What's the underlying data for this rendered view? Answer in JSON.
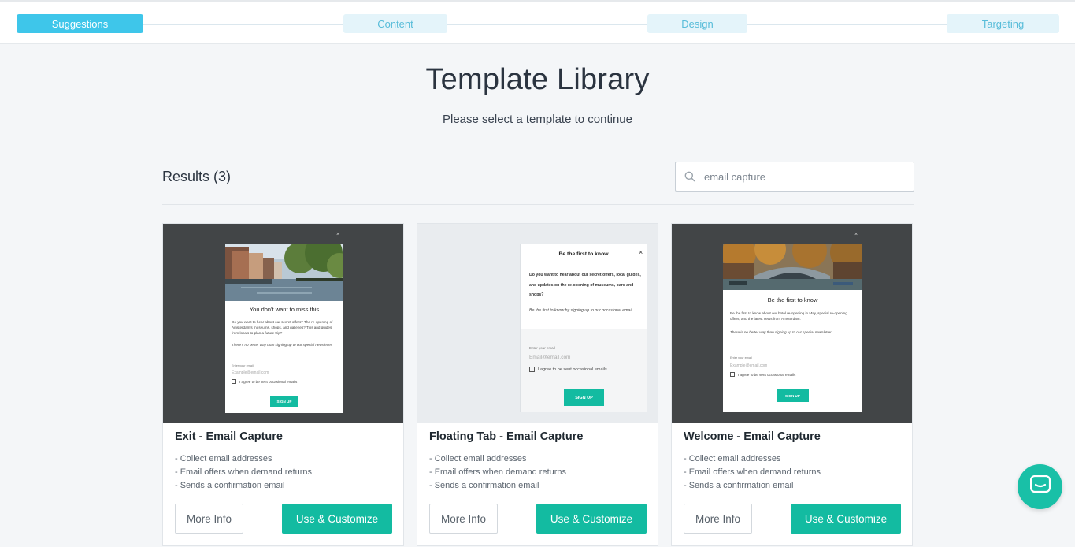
{
  "stepper": {
    "steps": [
      {
        "label": "Suggestions",
        "active": true
      },
      {
        "label": "Content",
        "active": false
      },
      {
        "label": "Design",
        "active": false
      },
      {
        "label": "Targeting",
        "active": false
      }
    ]
  },
  "header": {
    "title": "Template Library",
    "subtitle": "Please select a template to continue"
  },
  "results": {
    "label": "Results (3)"
  },
  "search": {
    "value": "email capture",
    "icon": "search-icon"
  },
  "cards": [
    {
      "title": "Exit - Email Capture",
      "features": [
        "- Collect email addresses",
        "- Email offers when demand returns",
        "- Sends a confirmation email"
      ],
      "more_info": "More Info",
      "use": "Use & Customize",
      "preview": {
        "headline": "You don't want to miss this",
        "body": "Do you want to hear about our secret offers? The re-opening of Amsterdam's museums, shops, and galleries? Tips and guides from locals to plan a future trip?",
        "italic": "There's no better way than signing up to our special newsletter.",
        "email_label": "Enter your email",
        "email_placeholder": "Example@email.com",
        "checkbox": "I agree to be sent occasional emails",
        "button": "SIGN UP"
      }
    },
    {
      "title": "Floating Tab - Email Capture",
      "features": [
        "- Collect email addresses",
        "- Email offers when demand returns",
        "- Sends a confirmation email"
      ],
      "more_info": "More Info",
      "use": "Use & Customize",
      "preview": {
        "headline": "Be the first to know",
        "body": "Do you want to hear about our secret offers, local guides, and updates on the re-opening of museums, bars and shops?",
        "italic": "Be the first to know by signing up to our occasional email.",
        "email_label": "Enter your email",
        "email_placeholder": "Email@email.com",
        "checkbox": "I agree to be sent occasional emails",
        "button": "SIGN UP"
      }
    },
    {
      "title": "Welcome - Email Capture",
      "features": [
        "- Collect email addresses",
        "- Email offers when demand returns",
        "- Sends a confirmation email"
      ],
      "more_info": "More Info",
      "use": "Use & Customize",
      "preview": {
        "headline": "Be the first to know",
        "body": "Be the first to know about our hotel re-opening in May, special re-opening offers, and the latest news from Amsterdam.",
        "italic": "There is no better way than signing up to our special newsletter.",
        "email_label": "Enter your email",
        "email_placeholder": "Example@email.com",
        "checkbox": "I agree to be sent occasional emails",
        "button": "SIGN UP"
      }
    }
  ],
  "colors": {
    "accent": "#13bba1",
    "step_active": "#3ec6ea",
    "step_inactive": "#e4f4fa"
  }
}
